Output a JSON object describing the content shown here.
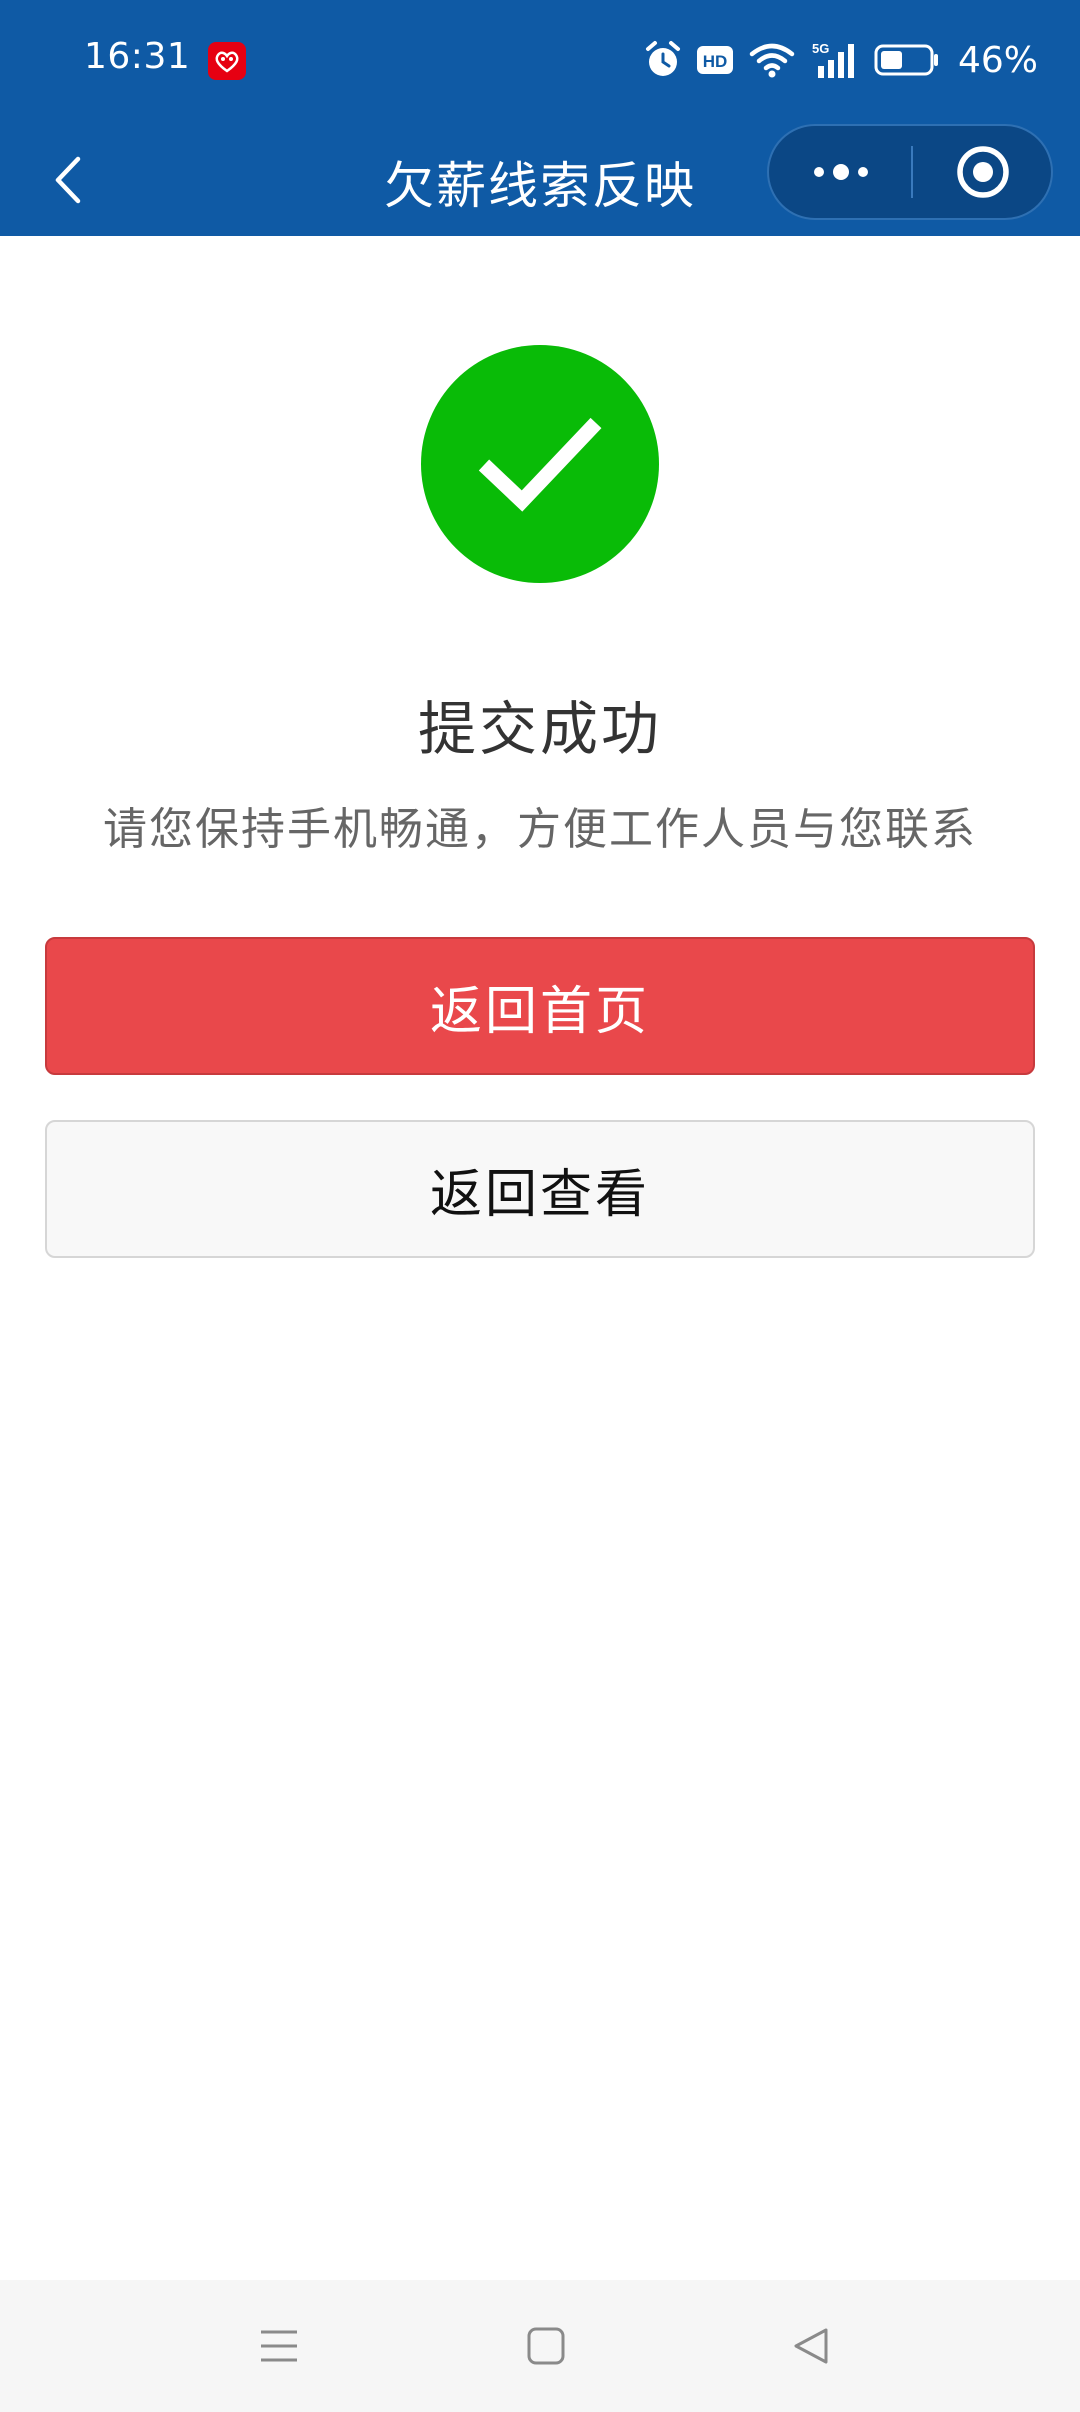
{
  "status_bar": {
    "time": "16:31",
    "battery_percent": "46%",
    "battery_level": 0.46,
    "network": "5G",
    "icons": [
      "app-notification-icon",
      "alarm-icon",
      "hd-icon",
      "wifi-icon",
      "signal-icon",
      "battery-icon"
    ]
  },
  "nav": {
    "title": "欠薪线索反映",
    "back_icon": "chevron-left-icon",
    "more_icon": "more-dots-icon",
    "close_icon": "target-circle-icon"
  },
  "result": {
    "icon": "check-circle-icon",
    "icon_color": "#09bb07",
    "title": "提交成功",
    "message": "请您保持手机畅通，方便工作人员与您联系"
  },
  "actions": {
    "primary_label": "返回首页",
    "primary_color": "#e9484b",
    "secondary_label": "返回查看"
  },
  "system_nav": {
    "icons": [
      "menu-icon",
      "home-icon",
      "back-triangle-icon"
    ]
  },
  "colors": {
    "header_bg": "#0f5aa5",
    "capsule_bg": "#0b4785"
  }
}
